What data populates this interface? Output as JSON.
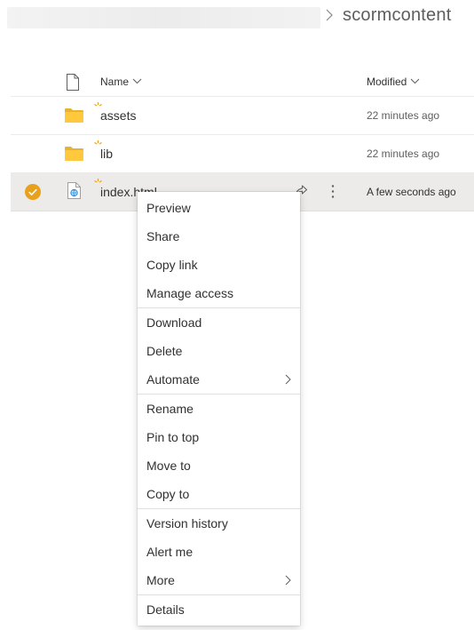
{
  "breadcrumb": {
    "current": "scormcontent"
  },
  "list_header": {
    "name_label": "Name",
    "modified_label": "Modified"
  },
  "rows": [
    {
      "name": "assets",
      "type": "folder",
      "modified": "22 minutes ago",
      "selected": false
    },
    {
      "name": "lib",
      "type": "folder",
      "modified": "22 minutes ago",
      "selected": false
    },
    {
      "name": "index.html",
      "type": "html",
      "modified": "A few seconds ago",
      "selected": true
    }
  ],
  "context_menu": {
    "groups": [
      [
        {
          "label": "Preview"
        },
        {
          "label": "Share"
        },
        {
          "label": "Copy link"
        },
        {
          "label": "Manage access"
        }
      ],
      [
        {
          "label": "Download"
        },
        {
          "label": "Delete"
        },
        {
          "label": "Automate",
          "submenu": true
        }
      ],
      [
        {
          "label": "Rename"
        },
        {
          "label": "Pin to top"
        },
        {
          "label": "Move to"
        },
        {
          "label": "Copy to"
        }
      ],
      [
        {
          "label": "Version history"
        },
        {
          "label": "Alert me"
        },
        {
          "label": "More",
          "submenu": true
        }
      ],
      [
        {
          "label": "Details"
        }
      ]
    ]
  },
  "colors": {
    "accent_orange": "#e8a11c",
    "folder_yellow": "#ffc83d",
    "selected_row_bg": "#edebe9",
    "text_primary": "#323130",
    "text_secondary": "#605e5c"
  }
}
